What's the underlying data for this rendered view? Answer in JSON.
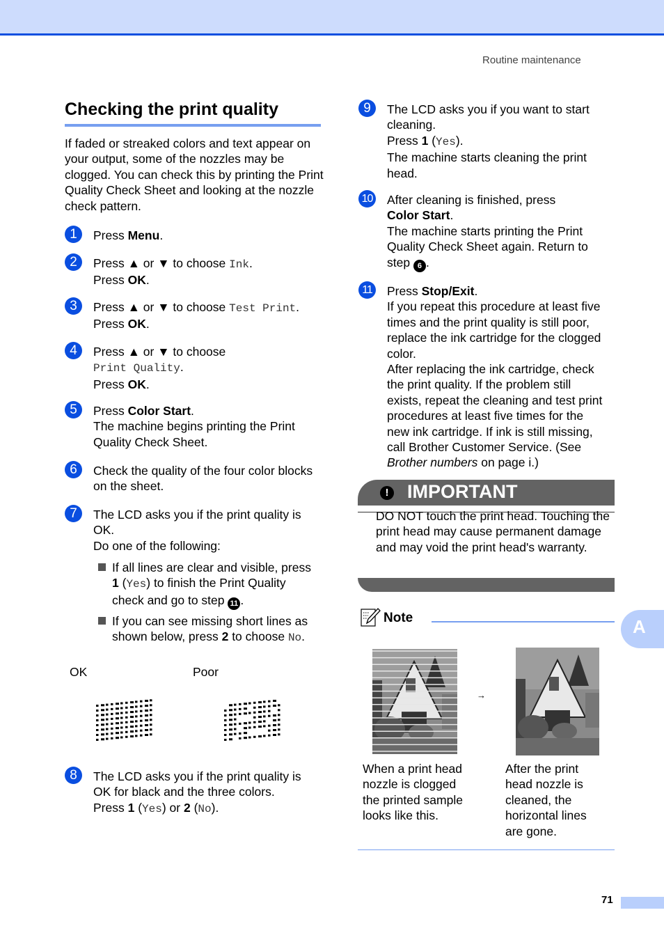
{
  "header": {
    "section": "Routine maintenance"
  },
  "title": "Checking the print quality",
  "intro": "If faded or streaked colors and text appear on your output, some of the nozzles may be clogged. You can check this by printing the Print Quality Check Sheet and looking at the nozzle check pattern.",
  "common": {
    "press": "Press ",
    "press_ok_prefix": "Press ",
    "ok": "OK",
    "period": ".",
    "up_down": "Press ▲ or ▼ to choose ",
    "yes": "Yes",
    "no": "No"
  },
  "steps": {
    "s1": {
      "num": "1",
      "key": "Menu"
    },
    "s2": {
      "num": "2",
      "option": "Ink"
    },
    "s3": {
      "num": "3",
      "option": "Test Print"
    },
    "s4": {
      "num": "4",
      "option": "Print Quality"
    },
    "s5": {
      "num": "5",
      "key": "Color Start",
      "line2": "The machine begins printing the Print",
      "line3": "Quality Check Sheet."
    },
    "s6": {
      "num": "6",
      "line1": "Check the quality of the four color blocks",
      "line2": "on the sheet."
    },
    "s7": {
      "num": "7",
      "line1": "The LCD asks you if the print quality is",
      "line2": "OK.",
      "line3": "Do one of the following:"
    },
    "s8": {
      "num": "8",
      "line1": "The LCD asks you if the print quality is",
      "line2": "OK for black and the three colors.",
      "key1": "1",
      "key2": "2",
      "or": " or "
    },
    "s9": {
      "num": "9",
      "line1": "The LCD asks you if you want to start",
      "line2": "cleaning.",
      "key": "1",
      "line4": "The machine starts cleaning the print",
      "line5": "head."
    },
    "s10": {
      "num": "10",
      "line1": "After cleaning is finished, press",
      "key": "Color Start",
      "line3": "The machine starts printing the Print",
      "line4": "Quality Check Sheet again. Return to",
      "line5_prefix": "step ",
      "ref": "6"
    },
    "s11": {
      "num": "11",
      "key": "Stop/Exit",
      "lines": [
        "If you repeat this procedure at least five",
        "times and the print quality is still poor,",
        "replace the ink cartridge for the clogged",
        "color.",
        "After replacing the ink cartridge, check",
        "the print quality. If the problem still",
        "exists, repeat the cleaning and test print",
        "procedures at least five times for the",
        "new ink cartridge. If ink is still missing,",
        "call Brother Customer Service. (See"
      ],
      "ref_italic": "Brother numbers",
      "ref_tail": " on page i.)"
    }
  },
  "bullets": {
    "b1": {
      "line1": "If all lines are clear and visible, press",
      "key": "1",
      "line2_tail": " to finish the Print Quality",
      "line3": "check and go to step ",
      "ref": "11"
    },
    "b2": {
      "line1": "If you can see missing short lines as",
      "line2_prefix": "shown below, press ",
      "key": "2",
      "line2_mid": " to choose "
    }
  },
  "patterns": {
    "ok_label": "OK",
    "poor_label": "Poor"
  },
  "important": {
    "icon": "exclamation-icon",
    "title": "IMPORTANT",
    "text": "DO NOT touch the print head. Touching the print head may cause permanent damage and may void the print head's warranty."
  },
  "note": {
    "icon": "note-pencil-icon",
    "title": "Note",
    "arrow": "→",
    "caption_before": "When a print head nozzle is clogged the printed sample looks like this.",
    "caption_after": "After the print head nozzle is cleaned, the horizontal lines are gone."
  },
  "side_tab": "A",
  "page_number": "71",
  "colors": {
    "accent": "#0a4ee0",
    "header_bg": "#cddcfd",
    "rule": "#779ff0",
    "important_bg": "#636363",
    "tab": "#b9cffc"
  }
}
